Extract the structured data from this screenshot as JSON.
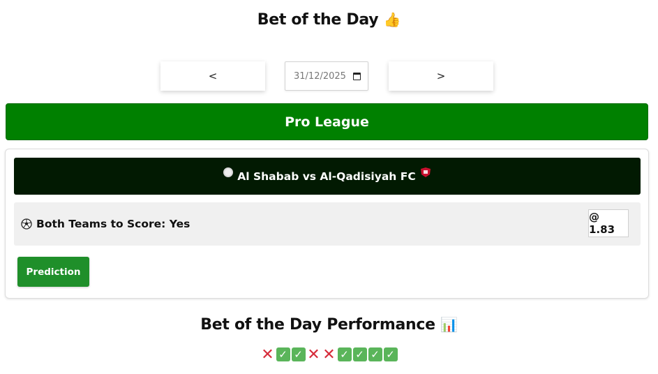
{
  "header": {
    "title": "Bet of the Day",
    "title_emoji": "👍"
  },
  "nav": {
    "prev_label": "<",
    "next_label": ">",
    "date_value": "31/12/2025"
  },
  "league": {
    "name": "Pro League"
  },
  "match": {
    "title": "Al Shabab vs Al-Qadisiyah FC",
    "home_badge": "al-shabab-logo",
    "away_badge": "al-qadisiyah-logo"
  },
  "bet": {
    "icon": "soccer-ball-icon",
    "label": "Both Teams to Score: Yes",
    "odds": "@ 1.83"
  },
  "prediction_button": "Prediction",
  "performance": {
    "title": "Bet of the Day Performance",
    "title_emoji": "📊",
    "results": [
      "loss",
      "win",
      "win",
      "loss",
      "loss",
      "win",
      "win",
      "win",
      "win"
    ]
  },
  "colors": {
    "league_green": "#008000",
    "match_bar": "#021a02",
    "prediction_green": "#1f8f2a",
    "win_green": "#5ab55a",
    "loss_red": "#d62b3a"
  }
}
